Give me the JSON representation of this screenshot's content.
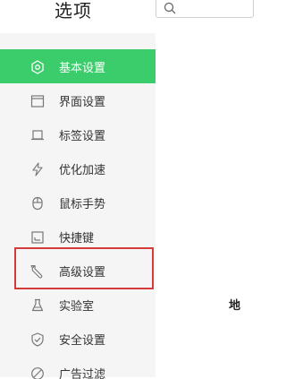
{
  "header": {
    "title": "选项",
    "search": {
      "placeholder": "",
      "icon": "search-icon"
    }
  },
  "sidebar": {
    "items": [
      {
        "label": "基本设置",
        "icon": "hexagon-gear-icon",
        "active": true
      },
      {
        "label": "界面设置",
        "icon": "window-icon",
        "active": false
      },
      {
        "label": "标签设置",
        "icon": "tab-icon",
        "active": false
      },
      {
        "label": "优化加速",
        "icon": "lightning-icon",
        "active": false
      },
      {
        "label": "鼠标手势",
        "icon": "mouse-icon",
        "active": false
      },
      {
        "label": "快捷键",
        "icon": "keyboard-shortcut-icon",
        "active": false
      },
      {
        "label": "高级设置",
        "icon": "wrench-icon",
        "active": false,
        "highlighted": true
      },
      {
        "label": "实验室",
        "icon": "flask-icon",
        "active": false
      },
      {
        "label": "安全设置",
        "icon": "shield-check-icon",
        "active": false
      },
      {
        "label": "广告过滤",
        "icon": "block-icon",
        "active": false
      }
    ]
  },
  "content": {
    "partial_text": "地"
  },
  "colors": {
    "accent": "#3bcc6b",
    "highlight_border": "#d43b3b",
    "sidebar_bg": "#f5f5f5"
  }
}
